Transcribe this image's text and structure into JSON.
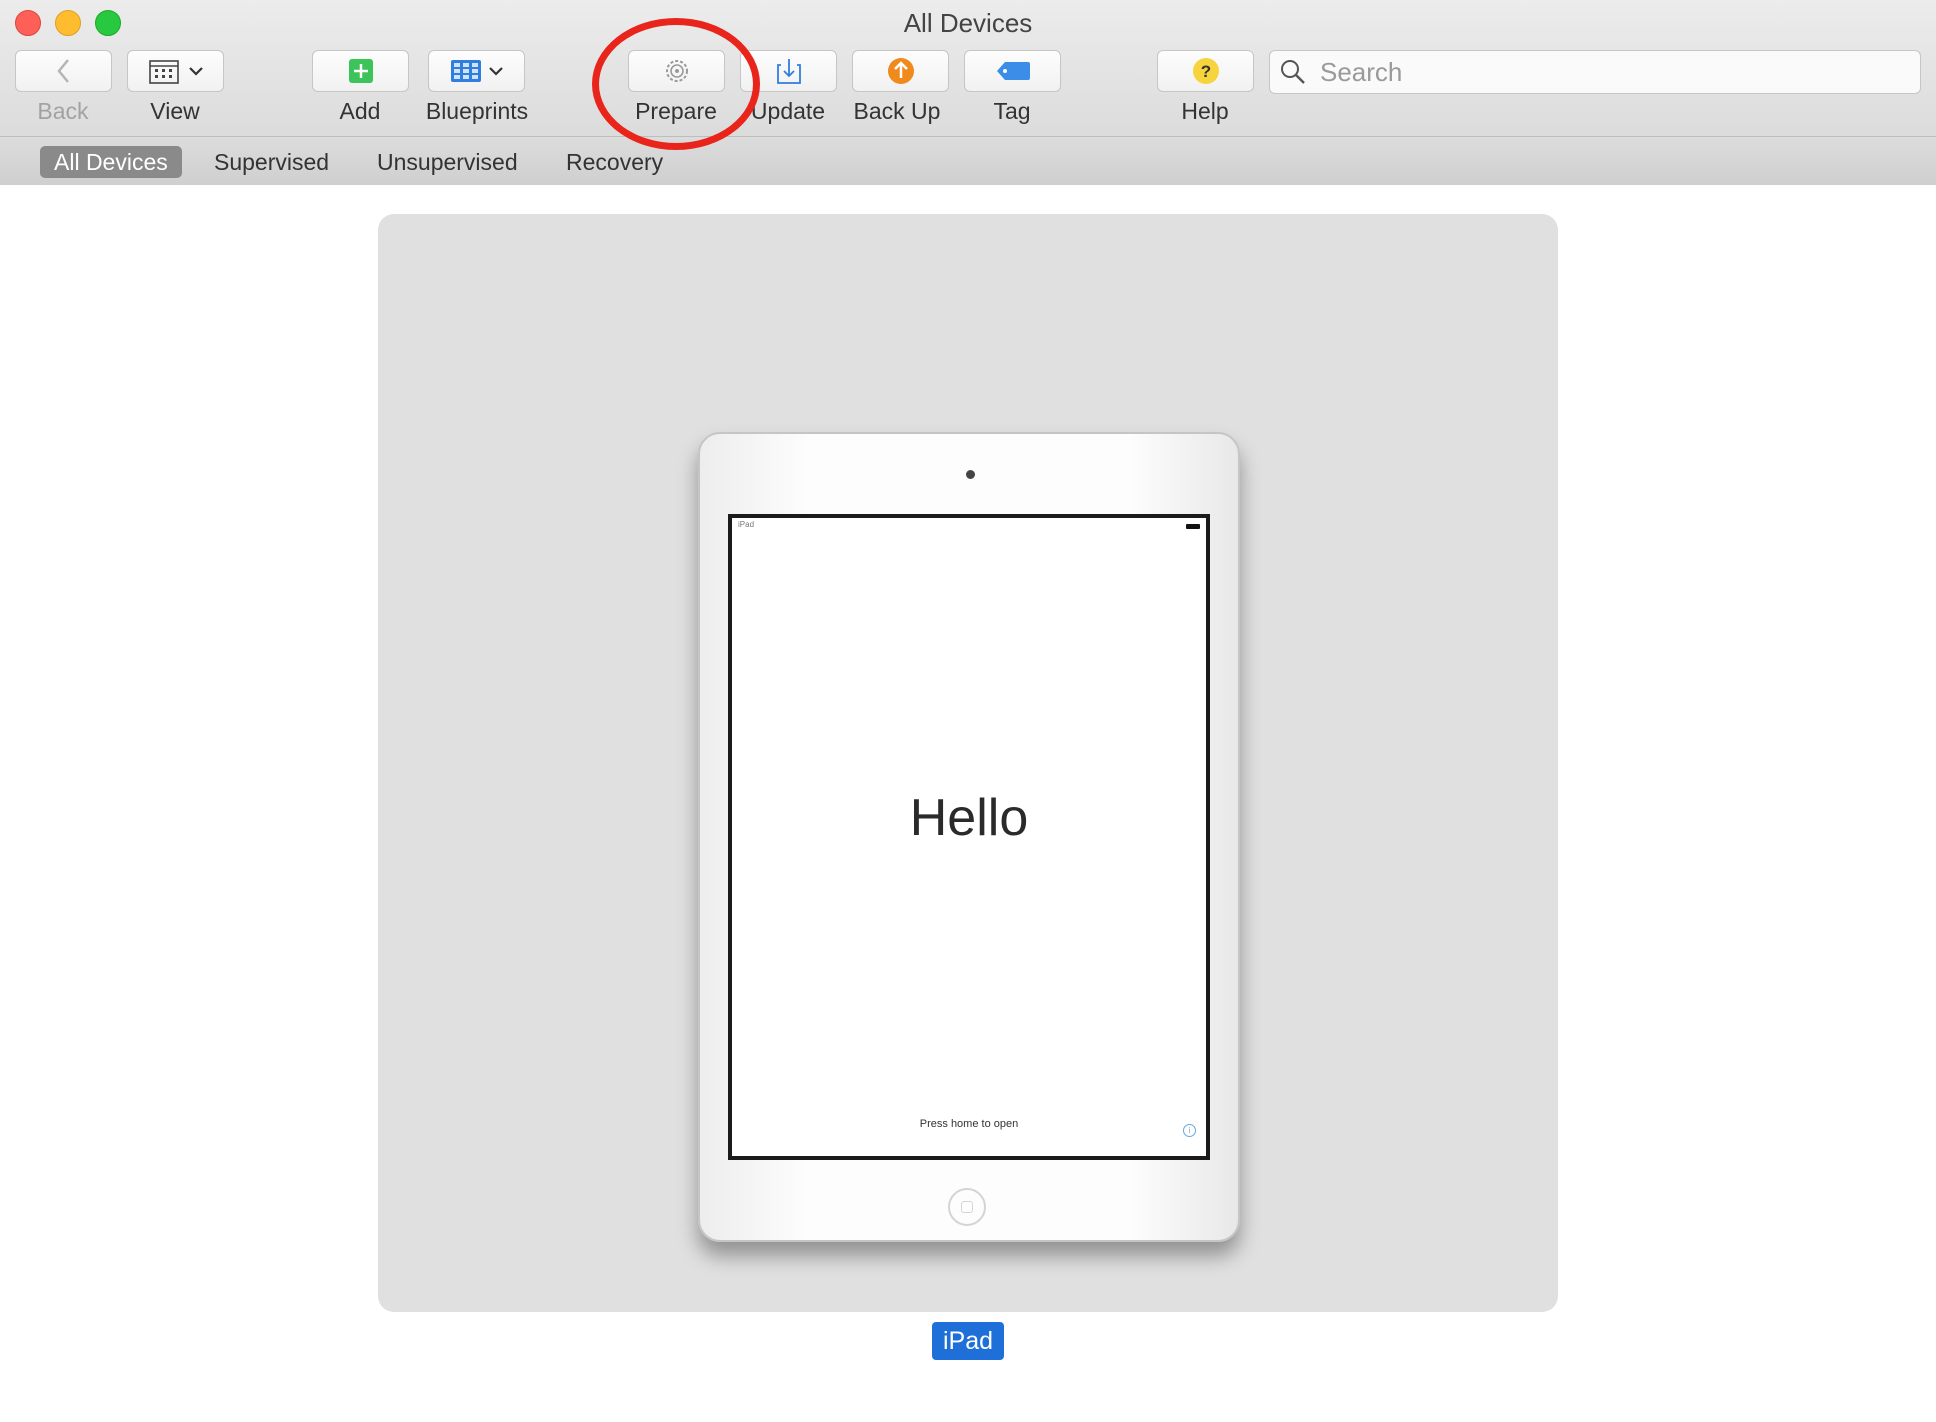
{
  "window": {
    "title": "All Devices"
  },
  "toolbar": {
    "back": {
      "label": "Back",
      "icon": "chevron-left-icon"
    },
    "view": {
      "label": "View",
      "icon": "calendar-grid-icon"
    },
    "add": {
      "label": "Add",
      "icon": "plus-icon",
      "color": "#3cc35a"
    },
    "blueprints": {
      "label": "Blueprints",
      "icon": "grid-icon",
      "color": "#2f7ee0"
    },
    "prepare": {
      "label": "Prepare",
      "icon": "gear-icon"
    },
    "update": {
      "label": "Update",
      "icon": "download-tray-icon",
      "color": "#2f7ee0"
    },
    "backup": {
      "label": "Back Up",
      "icon": "up-arrow-circle-icon",
      "color": "#f08a1c"
    },
    "tag": {
      "label": "Tag",
      "icon": "tag-icon",
      "color": "#3b8de8"
    },
    "help": {
      "label": "Help",
      "icon": "question-circle-icon",
      "color": "#f7d33c"
    }
  },
  "search": {
    "placeholder": "Search"
  },
  "filters": {
    "all": "All Devices",
    "supervised": "Supervised",
    "unsupervised": "Unsupervised",
    "recovery": "Recovery"
  },
  "device": {
    "name": "iPad",
    "screen_status_label": "iPad",
    "screen_greeting": "Hello",
    "screen_hint": "Press home to open"
  },
  "annotation": {
    "color": "#e8241b",
    "target": "prepare"
  }
}
